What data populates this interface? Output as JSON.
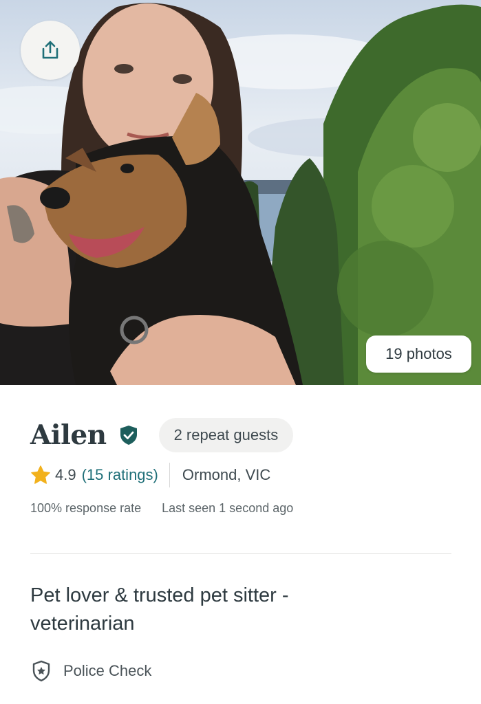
{
  "hero": {
    "photos_label": "19 photos",
    "share_icon": "share-icon"
  },
  "profile": {
    "name": "Ailen",
    "verified_icon": "verified-shield-icon",
    "repeat_guests": "2 repeat guests",
    "rating": "4.9",
    "ratings_count": "(15 ratings)",
    "location": "Ormond, VIC",
    "response_rate": "100% response rate",
    "last_seen": "Last seen 1 second ago"
  },
  "headline": {
    "line1": "Pet lover & trusted pet sitter -",
    "line2": "veterinarian"
  },
  "checks": [
    {
      "label": "Police Check",
      "icon": "police-check-shield-icon"
    }
  ],
  "colors": {
    "accent_teal": "#1f6f78",
    "verified_green": "#1d5e5c",
    "star_yellow": "#f2b11c",
    "text_dark": "#2e3a40",
    "badge_bg": "#f1f1f0"
  }
}
